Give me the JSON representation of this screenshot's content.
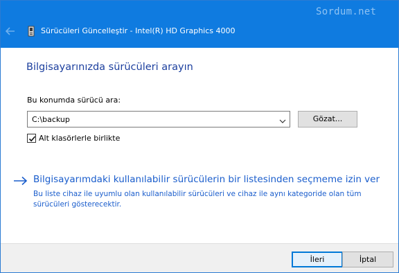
{
  "window": {
    "title": "Sürücüleri Güncelleştir - Intel(R) HD Graphics 4000",
    "watermark": "Sordum.net"
  },
  "main": {
    "heading": "Bilgisayarınızda sürücüleri arayın",
    "location_label": "Bu konumda sürücü ara:",
    "path_value": "C:\\backup",
    "browse_label": "Gözat...",
    "include_subfolders_label": "Alt klasörlerle birlikte",
    "include_subfolders_checked": true
  },
  "pick_link": {
    "title": "Bilgisayarımdaki kullanılabilir sürücülerin bir listesinden seçmeme izin ver",
    "description": "Bu liste cihaz ile uyumlu olan kullanılabilir sürücüleri ve cihaz ile aynı kategoride olan tüm sürücüleri gösterecektir."
  },
  "footer": {
    "next_label": "İleri",
    "cancel_label": "İptal"
  },
  "icons": {
    "back": "back-arrow-icon",
    "device": "device-icon",
    "dropdown": "chevron-down-icon",
    "link_arrow": "arrow-right-icon",
    "check": "checkmark-icon"
  },
  "colors": {
    "titlebar": "#0f7be0",
    "heading": "#1c3f9e",
    "link": "#1a5dcc",
    "footer": "#f0f0f0"
  }
}
